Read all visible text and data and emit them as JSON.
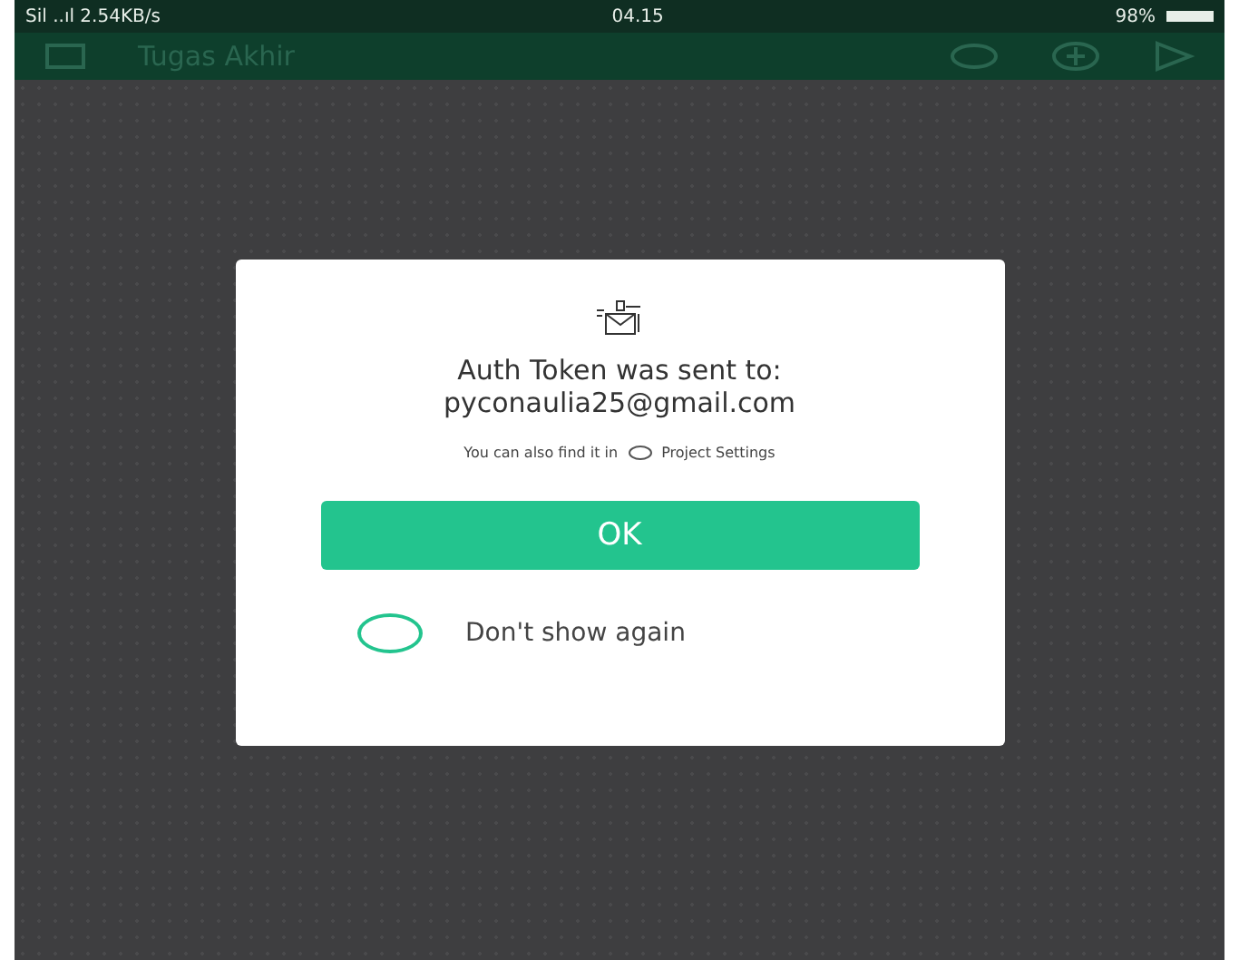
{
  "status_bar": {
    "signal": "Sil ..ıl 2.54KB/s",
    "time": "04.15",
    "battery": "98%"
  },
  "toolbar": {
    "title": "Tugas Akhir"
  },
  "dialog": {
    "heading": "Auth Token was sent to:",
    "email": "pyconaulia25@gmail.com",
    "hint_prefix": "You can also find it in",
    "hint_link": "Project Settings",
    "ok": "OK",
    "dont_show": {
      "label": "Don't show again",
      "checked": false
    }
  }
}
